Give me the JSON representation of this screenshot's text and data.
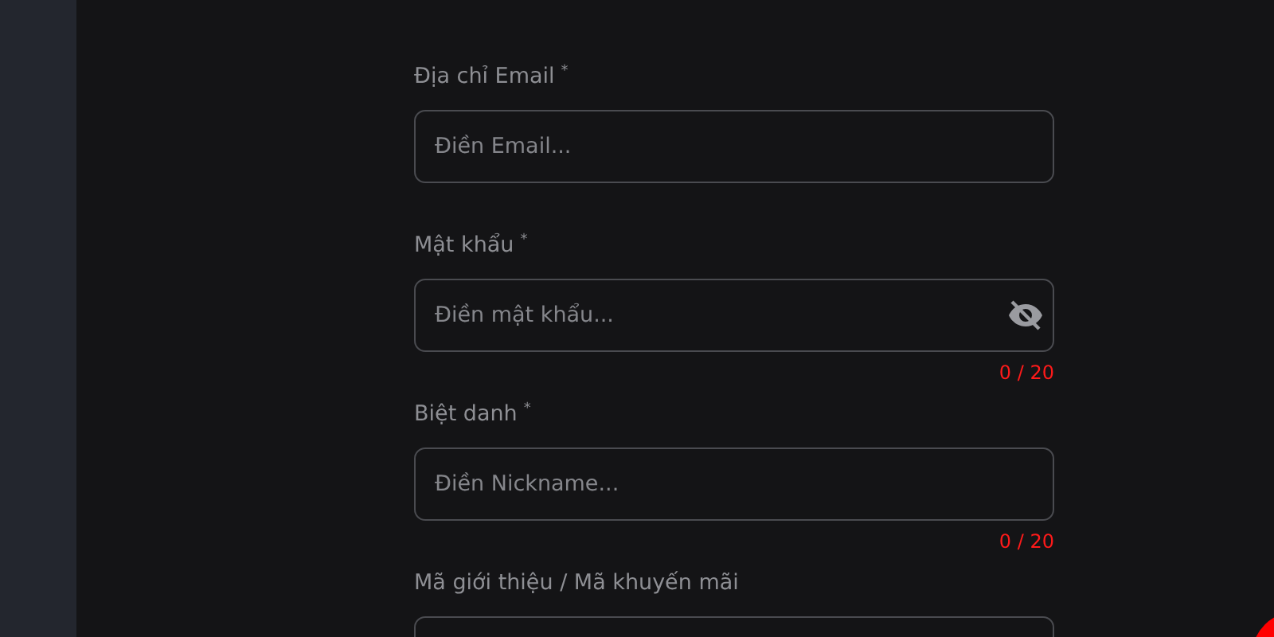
{
  "form": {
    "fields": [
      {
        "label": "Địa chỉ Email",
        "required_mark": "*",
        "placeholder": "Điền Email...",
        "kind": "text"
      },
      {
        "label": "Mật khẩu",
        "required_mark": "*",
        "placeholder": "Điền mật khẩu...",
        "kind": "password",
        "counter": "0 / 20"
      },
      {
        "label": "Biệt danh",
        "required_mark": "*",
        "placeholder": "Điền Nickname...",
        "kind": "text",
        "counter": "0 / 20"
      },
      {
        "label": "Mã giới thiệu / Mã khuyến mãi",
        "kind": "text"
      }
    ]
  }
}
